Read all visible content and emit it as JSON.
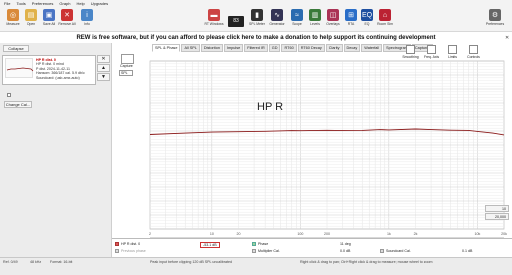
{
  "menu": [
    "File",
    "Tools",
    "Preferences",
    "Graph",
    "Help",
    "Upgrades"
  ],
  "toolbar": {
    "left": [
      {
        "name": "measure-icon",
        "label": "Measure",
        "color": "#d98a3a",
        "glyph": "◎"
      },
      {
        "name": "open-icon",
        "label": "Open",
        "color": "#e0b24a",
        "glyph": "▤"
      },
      {
        "name": "save-icon",
        "label": "Save All",
        "color": "#4a74c4",
        "glyph": "▣"
      },
      {
        "name": "remove-icon",
        "label": "Remove All",
        "color": "#cc3333",
        "glyph": "✕"
      },
      {
        "name": "info-icon",
        "label": "Info",
        "color": "#4a86c8",
        "glyph": "i"
      }
    ],
    "meter_value": "83",
    "right": [
      {
        "name": "rt-windows-icon",
        "label": "RT Windows",
        "color": "#c44",
        "glyph": "▬"
      },
      {
        "name": "spl-meter-icon",
        "label": "SPL Meter",
        "color": "#333",
        "glyph": "▮"
      },
      {
        "name": "generator-icon",
        "label": "Generator",
        "color": "#335",
        "glyph": "∿"
      },
      {
        "name": "scope-icon",
        "label": "Scope",
        "color": "#2b6cb0",
        "glyph": "≈"
      },
      {
        "name": "levels-icon",
        "label": "Levels",
        "color": "#3a7a3a",
        "glyph": "▥"
      },
      {
        "name": "overlays-icon",
        "label": "Overlays",
        "color": "#a35",
        "glyph": "◫"
      },
      {
        "name": "rta-icon",
        "label": "RTA",
        "color": "#2a6ec8",
        "glyph": "⊞"
      },
      {
        "name": "eq-icon",
        "label": "EQ",
        "color": "#1e4fa0",
        "glyph": "EQ"
      },
      {
        "name": "room-sim-icon",
        "label": "Room Sim",
        "color": "#b23",
        "glyph": "⌂"
      }
    ],
    "preferences_label": "Preferences"
  },
  "banner": "REW is free software, but if you can afford to please click here to make a donation to help support its continuing development",
  "left_panel": {
    "collapse_label": "Collapse",
    "measurement": {
      "title": "HP R dist. 0",
      "lines": [
        "HP R dist. 0 mind",
        "P dist. 2024-11-42-11",
        "Hansom: 366/187 cal. 5.9 db/c",
        "Soundcard: (usb-amx-auto)"
      ]
    },
    "change_cal_label": "Change Cal..."
  },
  "tabs": [
    "SPL & Phase",
    "All SPL",
    "Distortion",
    "Impulse",
    "Filtered IR",
    "GD",
    "RT60",
    "RT60 Decay",
    "Clarity",
    "Decay",
    "Waterfall",
    "Spectrogram",
    "Captures"
  ],
  "right_tools": [
    "Smoothing",
    "Freq. Axis",
    "Limits",
    "Controls"
  ],
  "plot_side": {
    "capture_label": "Capture",
    "select_value": "SPL"
  },
  "zoom": {
    "top": "10",
    "bottom": "20,000"
  },
  "chart_data": {
    "type": "line",
    "title": "HP R",
    "x_scale": "log",
    "xlim": [
      2,
      20000
    ],
    "x_ticks": [
      "2",
      "3",
      "4",
      "5",
      "6",
      "7",
      "8",
      "9",
      "10",
      "20",
      "30",
      "40",
      "50",
      "60",
      "70",
      "80",
      "90",
      "100",
      "200",
      "300",
      "400",
      "500",
      "600",
      "700",
      "800",
      "900",
      "1k",
      "2k",
      "3k",
      "4k",
      "5k",
      "6k",
      "7k",
      "8k",
      "9k",
      "10k",
      "20k"
    ],
    "ylim": [
      -70,
      50
    ],
    "grid": true,
    "series": [
      {
        "name": "HP R dist. 0",
        "color": "#8b1a1a",
        "x": [
          2,
          5,
          10,
          20,
          40,
          80,
          100,
          200,
          300,
          500,
          800,
          1000,
          2000,
          3000,
          5000,
          8000,
          10000,
          15000,
          20000
        ],
        "y": [
          -2.5,
          -1.5,
          -0.8,
          -0.5,
          -0.2,
          0.3,
          0.2,
          0.5,
          0.3,
          0.4,
          1.0,
          0.8,
          1.4,
          1.0,
          0.6,
          0.4,
          -0.3,
          -1.5,
          -2.8
        ]
      }
    ]
  },
  "legend": {
    "name": "HP R dist. 0",
    "value": "-53.1 dB",
    "items": [
      "Phase",
      "Multiplier Cal.",
      "Soundcard Cal.",
      "Previous phase"
    ],
    "values": [
      "11 deg",
      "0.0 dB",
      "0.1 dB"
    ]
  },
  "status": {
    "left": [
      "Ref. 0/49",
      "48 kHz",
      "Format: 16-bit"
    ],
    "middle": "Peak input before clipping 120 dB SPL uncalibrated",
    "right": "Right click & drag to pan; Ctrl+Right click & drag to measure; mouse wheel to zoom"
  }
}
